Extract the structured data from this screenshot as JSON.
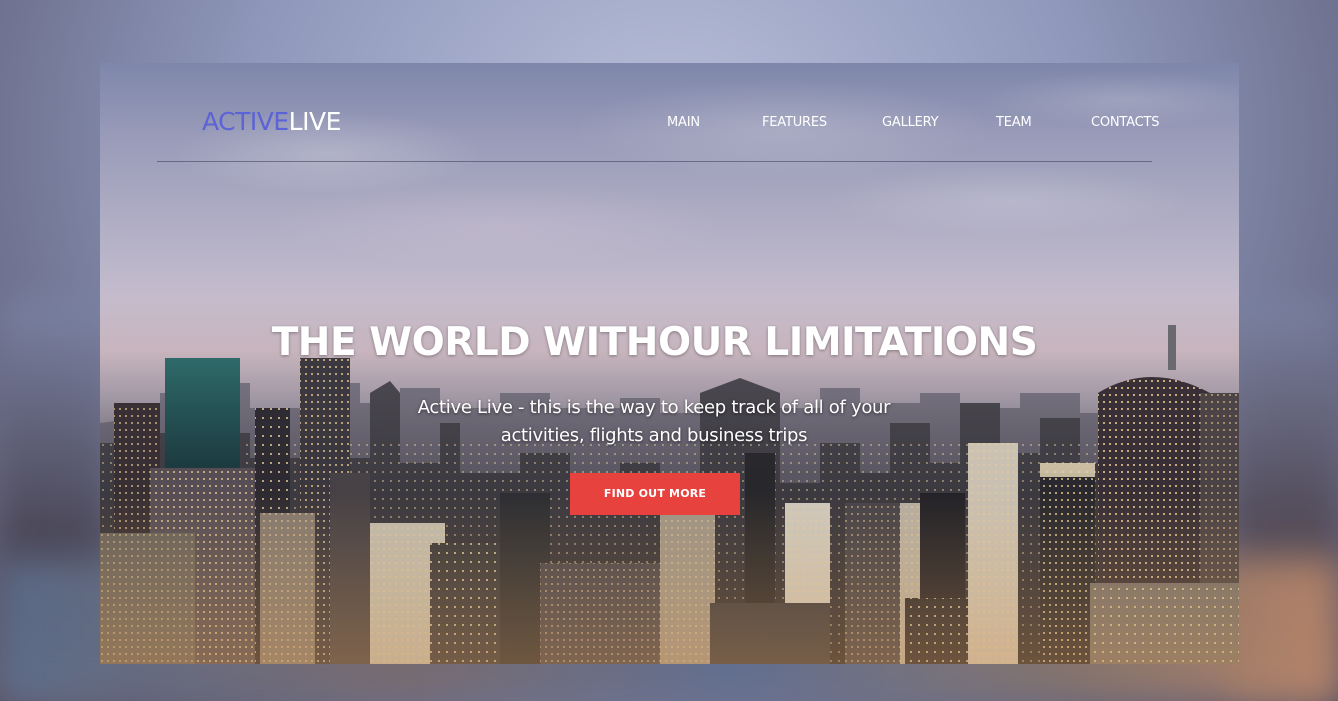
{
  "header": {
    "logo_part1": "ACTIVE",
    "logo_part2": "LIVE",
    "nav": [
      "MAIN",
      "FEATURES",
      "GALLERY",
      "TEAM",
      "CONTACTS"
    ]
  },
  "hero": {
    "title": "THE WORLD WITHOUR LIMITATIONS",
    "subtitle": "Active Live - this is the way to keep track of all of your activities, flights and business trips",
    "cta_label": "FIND OUT MORE"
  },
  "colors": {
    "accent": "#e8423f",
    "logo_blue": "#5b63d6",
    "text": "#ffffff"
  },
  "icons": []
}
